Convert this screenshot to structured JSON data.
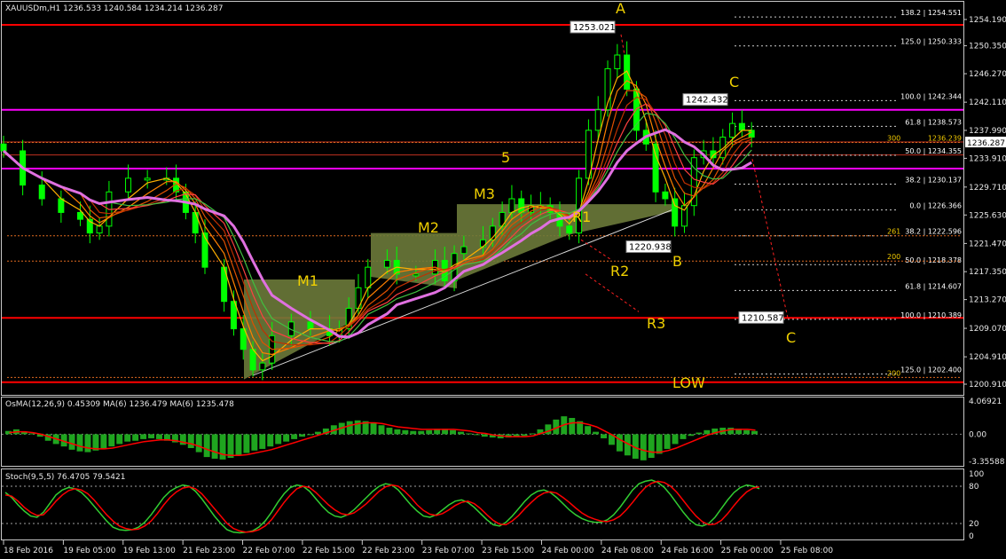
{
  "header": {
    "main": "XAUUSDm,H1  1236.533 1240.584 1234.214 1236.287",
    "osma": "OsMA(12,26,9) 0.45309  MA(6) 1236.479  MA(6) 1235.478",
    "stoch": "Stoch(9,5,5) 76.4705 79.5421"
  },
  "colors": {
    "background": "#000000",
    "grid": "#c0c0c0",
    "bull_candle": "#00ff00",
    "support_red": "#ff0000",
    "magenta": "#ff00ff",
    "slow_ma": "#e070e0",
    "annotation": "#f0d000",
    "triangle_fill": "#6b7a3a",
    "osma_bar": "#1fa51f",
    "osma_signal": "#ff0000",
    "stoch_main": "#32cd32",
    "stoch_signal": "#ff0000"
  },
  "chart_data": [
    {
      "type": "candlestick",
      "symbol": "XAUUSDm",
      "timeframe": "H1",
      "ylim": [
        1200.0,
        1256.0
      ],
      "yticks": [
        "1254.190",
        "1250.350",
        "1246.270",
        "1242.110",
        "1237.990",
        "1233.910",
        "1229.710",
        "1225.630",
        "1221.470",
        "1217.350",
        "1213.270",
        "1209.070",
        "1204.910",
        "1200.910"
      ],
      "current_price": "1236.287",
      "xticks": [
        "18 Feb 2016",
        "19 Feb 05:00",
        "19 Feb 13:00",
        "21 Feb 23:00",
        "22 Feb 07:00",
        "22 Feb 15:00",
        "22 Feb 23:00",
        "23 Feb 07:00",
        "23 Feb 15:00",
        "24 Feb 00:00",
        "24 Feb 08:00",
        "24 Feb 16:00",
        "25 Feb 00:00",
        "25 Feb 08:00"
      ],
      "horizontal_lines": [
        {
          "price": 1253.4,
          "color": "red"
        },
        {
          "price": 1241.0,
          "color": "magenta"
        },
        {
          "price": 1232.4,
          "color": "magenta"
        },
        {
          "price": 1210.6,
          "color": "red"
        },
        {
          "price": 1201.2,
          "color": "red"
        }
      ],
      "fib_levels": [
        {
          "label": "138.2 | 1254.551",
          "price": 1254.551
        },
        {
          "label": "125.0 | 1250.333",
          "price": 1250.333
        },
        {
          "label": "100.0 | 1242.344",
          "price": 1242.344
        },
        {
          "label": "61.8 | 1238.573",
          "price": 1238.573
        },
        {
          "label": "50.0 | 1234.355",
          "price": 1234.355
        },
        {
          "label": "38.2 | 1230.137",
          "price": 1230.137
        },
        {
          "label": "0.0 | 1226.366",
          "price": 1226.366
        },
        {
          "label": "38.2 | 1222.596",
          "price": 1222.596
        },
        {
          "label": "50.0 | 1218.378",
          "price": 1218.378
        },
        {
          "label": "61.8 | 1214.607",
          "price": 1214.607
        },
        {
          "label": "100.0 | 1210.389",
          "price": 1210.389
        },
        {
          "label": "125.0 | 1202.400",
          "price": 1202.4
        }
      ],
      "fib_ext_levels": [
        {
          "label": "300",
          "value": "1236.239",
          "price": 1236.239
        },
        {
          "label": "261",
          "price": 1222.596
        },
        {
          "label": "200",
          "price": 1218.9
        },
        {
          "label": "200",
          "price": 1201.9
        }
      ],
      "price_boxes": [
        {
          "label": "1253.021",
          "price": 1253.021
        },
        {
          "label": "1242.432",
          "price": 1242.432
        },
        {
          "label": "1220.938",
          "price": 1220.938
        },
        {
          "label": "1210.587",
          "price": 1210.587
        }
      ],
      "annotations": [
        "A",
        "C",
        "5",
        "M3",
        "M2",
        "M1",
        "R1",
        "R2",
        "R3",
        "B",
        "C",
        "LOW"
      ]
    },
    {
      "type": "bar",
      "name": "OsMA(12,26,9)",
      "ylim": [
        -3.55,
        4.07
      ],
      "yticks": [
        "4.06921",
        "0.00",
        "-3.35588"
      ],
      "values": [
        0.4,
        0.6,
        0.3,
        0.1,
        -0.3,
        -0.8,
        -1.2,
        -1.5,
        -1.9,
        -2.1,
        -2.2,
        -2.0,
        -1.8,
        -1.5,
        -1.2,
        -0.9,
        -0.8,
        -0.6,
        -0.5,
        -0.6,
        -0.8,
        -1.0,
        -1.3,
        -1.7,
        -2.2,
        -2.8,
        -3.0,
        -3.1,
        -2.9,
        -2.6,
        -2.3,
        -2.0,
        -1.8,
        -1.5,
        -1.2,
        -0.9,
        -0.6,
        -0.3,
        0.0,
        0.3,
        0.7,
        1.1,
        1.4,
        1.6,
        1.7,
        1.6,
        1.4,
        1.1,
        0.8,
        0.6,
        0.5,
        0.4,
        0.4,
        0.5,
        0.6,
        0.6,
        0.5,
        0.3,
        0.1,
        -0.1,
        -0.3,
        -0.4,
        -0.5,
        -0.4,
        -0.3,
        -0.2,
        0.1,
        0.6,
        1.2,
        1.8,
        2.2,
        2.0,
        1.6,
        1.0,
        0.3,
        -0.5,
        -1.3,
        -2.1,
        -2.6,
        -3.0,
        -3.2,
        -2.9,
        -2.4,
        -1.8,
        -1.2,
        -0.6,
        -0.2,
        0.2,
        0.5,
        0.7,
        0.8,
        0.8,
        0.6,
        0.5,
        0.4
      ],
      "signal": [
        0.2,
        0.3,
        0.3,
        0.2,
        0.0,
        -0.3,
        -0.6,
        -0.9,
        -1.2,
        -1.5,
        -1.7,
        -1.8,
        -1.8,
        -1.7,
        -1.5,
        -1.3,
        -1.1,
        -0.9,
        -0.8,
        -0.7,
        -0.7,
        -0.8,
        -1.0,
        -1.2,
        -1.5,
        -1.9,
        -2.2,
        -2.5,
        -2.6,
        -2.6,
        -2.5,
        -2.3,
        -2.1,
        -1.9,
        -1.6,
        -1.3,
        -1.0,
        -0.7,
        -0.4,
        -0.1,
        0.2,
        0.5,
        0.8,
        1.1,
        1.3,
        1.4,
        1.4,
        1.3,
        1.1,
        0.9,
        0.8,
        0.7,
        0.6,
        0.6,
        0.6,
        0.6,
        0.6,
        0.5,
        0.4,
        0.2,
        0.1,
        -0.1,
        -0.2,
        -0.3,
        -0.3,
        -0.3,
        -0.2,
        0.1,
        0.4,
        0.8,
        1.2,
        1.4,
        1.4,
        1.2,
        0.9,
        0.4,
        -0.1,
        -0.7,
        -1.2,
        -1.7,
        -2.0,
        -2.2,
        -2.2,
        -2.0,
        -1.7,
        -1.3,
        -0.9,
        -0.5,
        -0.1,
        0.2,
        0.4,
        0.6,
        0.6,
        0.6,
        0.5
      ]
    },
    {
      "type": "line",
      "name": "Stoch(9,5,5)",
      "ylim": [
        0,
        100
      ],
      "yticks": [
        "100",
        "80",
        "20",
        "0"
      ],
      "levels": [
        80,
        20
      ],
      "series": [
        {
          "values": [
            70,
            62,
            50,
            40,
            32,
            30,
            38,
            52,
            66,
            74,
            78,
            76,
            70,
            60,
            48,
            36,
            24,
            14,
            10,
            9,
            10,
            14,
            22,
            34,
            48,
            62,
            72,
            78,
            82,
            80,
            72,
            60,
            46,
            32,
            20,
            10,
            6,
            5,
            6,
            8,
            14,
            24,
            38,
            54,
            68,
            78,
            82,
            80,
            72,
            60,
            48,
            38,
            32,
            30,
            34,
            42,
            52,
            62,
            72,
            80,
            84,
            82,
            74,
            62,
            50,
            40,
            32,
            30,
            34,
            42,
            50,
            56,
            58,
            54,
            46,
            36,
            26,
            18,
            16,
            22,
            32,
            44,
            56,
            66,
            72,
            74,
            70,
            62,
            52,
            42,
            34,
            28,
            24,
            22,
            22,
            26,
            34,
            46,
            60,
            74,
            84,
            88,
            90,
            86,
            78,
            66,
            52,
            38,
            26,
            18,
            16,
            20,
            30,
            44,
            58,
            70,
            78,
            82,
            80,
            76
          ]
        },
        {
          "values": [
            66,
            64,
            56,
            46,
            38,
            33,
            34,
            44,
            56,
            66,
            73,
            76,
            74,
            68,
            58,
            46,
            34,
            24,
            16,
            12,
            10,
            11,
            16,
            24,
            36,
            50,
            62,
            71,
            77,
            79,
            76,
            68,
            56,
            44,
            32,
            20,
            12,
            8,
            6,
            7,
            10,
            16,
            26,
            40,
            54,
            66,
            76,
            80,
            78,
            70,
            60,
            50,
            42,
            36,
            34,
            37,
            44,
            52,
            62,
            72,
            79,
            82,
            80,
            72,
            62,
            50,
            41,
            35,
            33,
            36,
            42,
            49,
            54,
            56,
            52,
            44,
            34,
            25,
            19,
            18,
            24,
            33,
            44,
            54,
            63,
            69,
            71,
            69,
            62,
            54,
            45,
            37,
            31,
            27,
            24,
            23,
            26,
            32,
            42,
            54,
            67,
            78,
            85,
            88,
            86,
            80,
            70,
            57,
            44,
            32,
            23,
            18,
            19,
            25,
            36,
            49,
            61,
            71,
            77,
            79
          ]
        }
      ]
    }
  ]
}
